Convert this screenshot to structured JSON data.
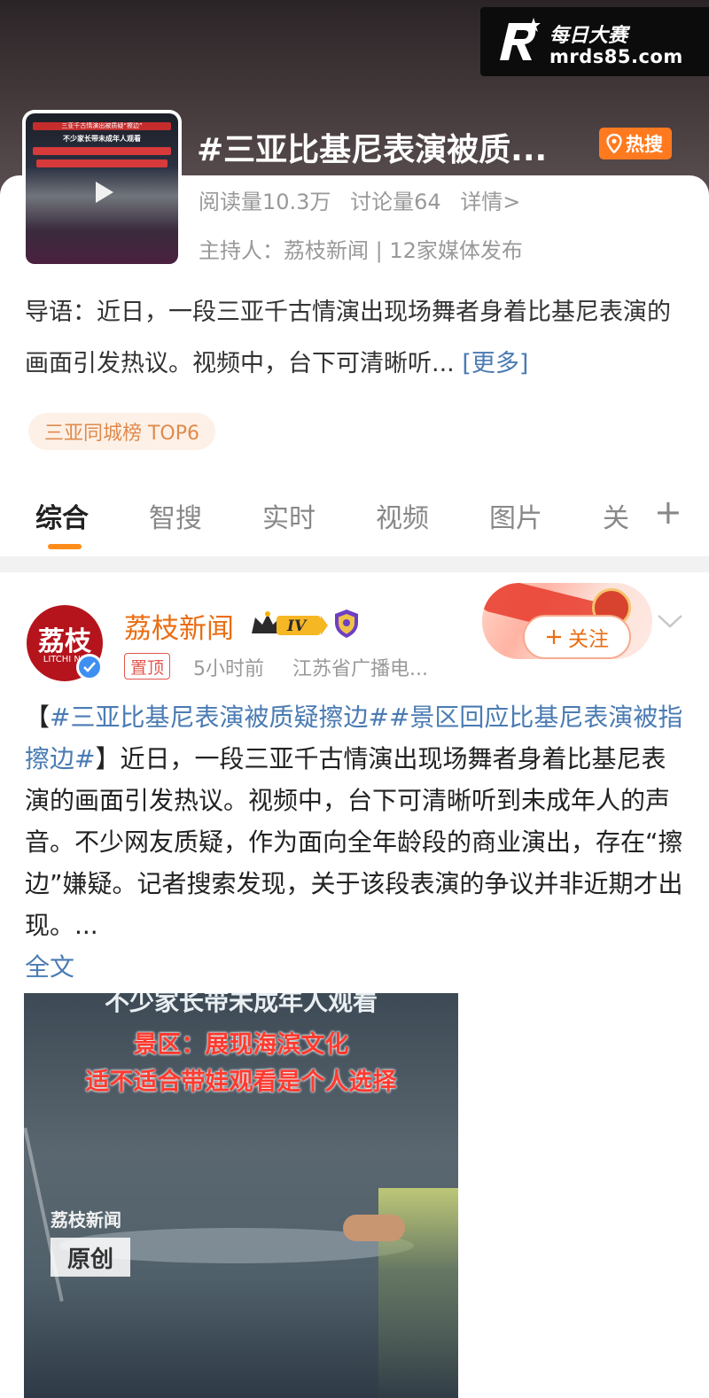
{
  "watermark": {
    "brand_top": "每日大赛",
    "brand_bottom": "mrds85.com"
  },
  "topic": {
    "title": "#三亚比基尼表演被质...",
    "hot_badge": "热搜",
    "stats": {
      "reads": "阅读量10.3万",
      "discussions": "讨论量64",
      "details": "详情>"
    },
    "host": "主持人：荔枝新闻 | 12家媒体发布",
    "lead": "导语：近日，一段三亚千古情演出现场舞者身着比基尼表演的画面引发热议。视频中，台下可清晰听...",
    "lead_more": "[更多]",
    "rank_pill": "三亚同城榜 TOP6",
    "thumbnail_text": {
      "line1": "三亚千古情演出被质疑“擦边”",
      "line2": "不少家长带未成年人观看"
    }
  },
  "tabs": [
    {
      "label": "综合",
      "active": true
    },
    {
      "label": "智搜",
      "active": false
    },
    {
      "label": "实时",
      "active": false
    },
    {
      "label": "视频",
      "active": false
    },
    {
      "label": "图片",
      "active": false
    },
    {
      "label": "关",
      "active": false
    }
  ],
  "tabs_plus": "+",
  "post": {
    "author": "荔枝新闻",
    "level_badge": "IV",
    "avatar_text": "荔枝",
    "avatar_subtext": "LITCHI NE",
    "pin_tag": "置顶",
    "time": "5小时前",
    "source": "江苏省广播电...",
    "follow_label": "关注",
    "text": {
      "open_bracket": "【",
      "hashtag1": "#三亚比基尼表演被质疑擦边#",
      "hashtag2": "#景区回应比基尼表演被指擦边#",
      "close_bracket": "】",
      "body": "近日，一段三亚千古情演出现场舞者身着比基尼表演的画面引发热议。视频中，台下可清晰听到未成年人的声音。不少网友质疑，作为面向全年龄段的商业演出，存在“擦边”嫌疑。记者搜索发现，关于该段表演的争议并非近期才出现。...",
      "full_text": "全文"
    }
  },
  "video": {
    "top_cut_text": "不少家长带未成年人观看",
    "caption1": "景区：展现海滨文化",
    "caption2": "适不适合带娃观看是个人选择",
    "brand": "荔枝新闻",
    "original": "原创"
  },
  "colors": {
    "accent_orange": "#ff7a1f",
    "author_orange": "#ea6d12",
    "link_blue": "#4a7bb3",
    "brand_red": "#b5141c"
  }
}
